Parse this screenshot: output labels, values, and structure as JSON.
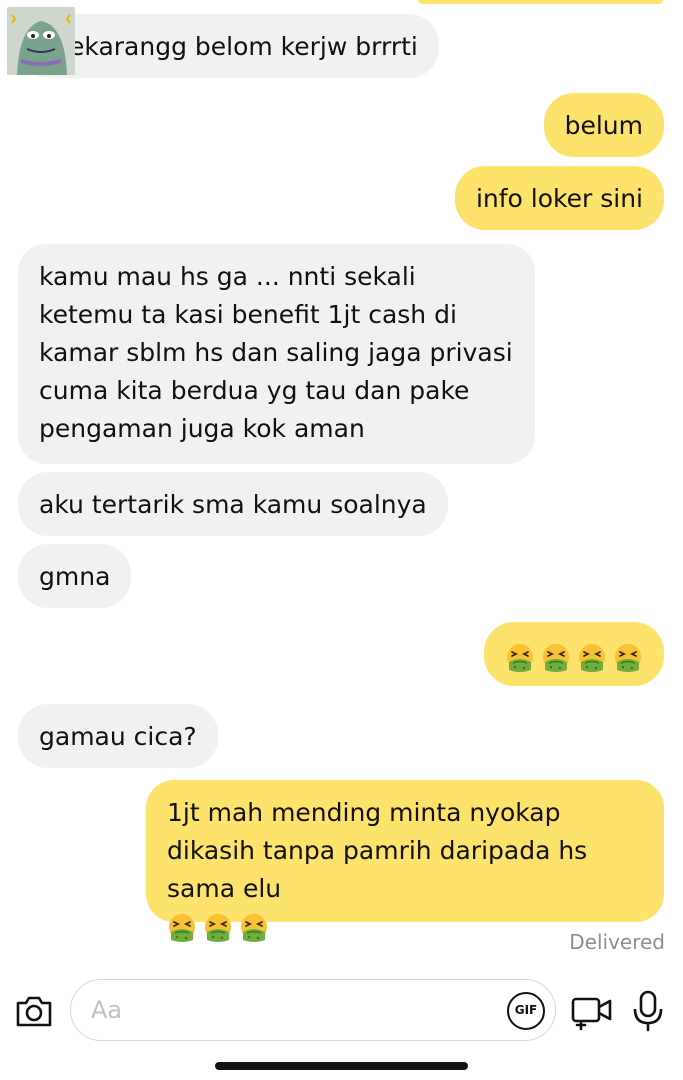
{
  "messages": [
    {
      "from": "them",
      "text": "sekarangg belom kerjw brrrti"
    },
    {
      "from": "me",
      "text": "belum"
    },
    {
      "from": "me",
      "text": "info loker sini"
    },
    {
      "from": "them",
      "text": "kamu mau hs ga ... nnti sekali ketemu ta kasi benefit 1jt cash di kamar sblm hs dan saling jaga privasi cuma kita berdua yg tau dan pake pengaman juga kok aman"
    },
    {
      "from": "them",
      "text": "aku tertarik sma kamu soalnya"
    },
    {
      "from": "them",
      "text": "gmna"
    },
    {
      "from": "me",
      "emoji": "nauseated-face-emoji",
      "emoji_count": 4
    },
    {
      "from": "them",
      "text": "gamau cica?"
    },
    {
      "from": "me",
      "text": "1jt mah mending minta nyokap dikasih tanpa pamrih daripada hs sama elu",
      "emoji": "nauseated-face-emoji",
      "emoji_count": 3
    }
  ],
  "status": {
    "delivered": "Delivered"
  },
  "composer": {
    "placeholder": "Aa",
    "gif_label": "GIF",
    "icons": [
      "camera-icon",
      "gif-icon",
      "video-call-icon",
      "microphone-icon"
    ]
  },
  "colors": {
    "outgoing_bubble": "#fde26b",
    "incoming_bubble": "#f1f1f1",
    "status_text": "#8e8e8e"
  }
}
